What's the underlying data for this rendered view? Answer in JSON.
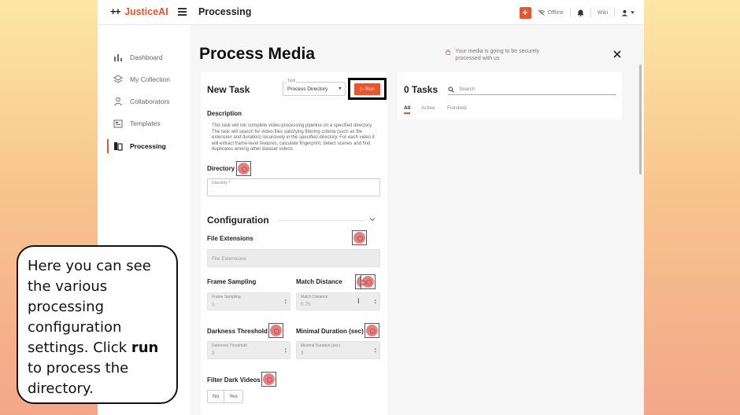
{
  "app": {
    "brand_plus": "++",
    "brand_name": "JusticeAI",
    "page_heading": "Processing"
  },
  "topbar": {
    "add_label": "+",
    "offline_label": "Offline",
    "wiki_label": "Wiki"
  },
  "sidebar": {
    "items": [
      {
        "label": "Dashboard",
        "icon": "bar-chart-icon"
      },
      {
        "label": "My Collection",
        "icon": "layers-icon"
      },
      {
        "label": "Collaborators",
        "icon": "person-icon"
      },
      {
        "label": "Templates",
        "icon": "template-icon"
      },
      {
        "label": "Processing",
        "icon": "processing-icon",
        "active": true
      }
    ]
  },
  "main": {
    "title": "Process Media",
    "secure_note": "Your media is going to be securely processed with us"
  },
  "task_panel": {
    "heading": "New Task",
    "task_select_label": "Task",
    "task_select_value": "Process Directory",
    "run_label": "Run",
    "description_label": "Description",
    "description_text": "This task will run complete video-processing pipeline on a specified directory. The task will search for video-files satisfying filtering criteria (such as file extension and duration) recursively in the specified directory. For each video it will extract frame-level features, calculate fingerprint, detect scenes and find duplicates among other dataset videos",
    "directory_label": "Directory",
    "directory_field_label": "Directory *",
    "directory_value": ".",
    "configuration_label": "Configuration",
    "file_extensions_label": "File Extensions",
    "file_extensions_placeholder": "File Extensions",
    "frame_sampling_label": "Frame Sampling",
    "frame_sampling_field_label": "Frame Sampling",
    "frame_sampling_value": "1",
    "match_distance_label": "Match Distance",
    "match_distance_field_label": "Match Distance",
    "match_distance_value": "0.75",
    "darkness_threshold_label": "Darkness Threshold",
    "darkness_threshold_field_label": "Darkness Threshold",
    "darkness_threshold_value": "2",
    "minimal_duration_label": "Minimal Duration (sec)",
    "minimal_duration_field_label": "Minimal Duration (sec)",
    "minimal_duration_value": "3",
    "filter_dark_label": "Filter Dark Videos",
    "filter_dark_no": "No",
    "filter_dark_yes": "Yes"
  },
  "tasks_panel": {
    "heading": "0 Tasks",
    "search_placeholder": "Search",
    "tabs": [
      "All",
      "Active",
      "Finished"
    ]
  },
  "callout": {
    "text_before": "Here you can see the various processing configuration settings. Click ",
    "bold": "run",
    "text_after": " to process the directory."
  },
  "colors": {
    "accent": "#e8552f",
    "marker": "#e58080"
  }
}
